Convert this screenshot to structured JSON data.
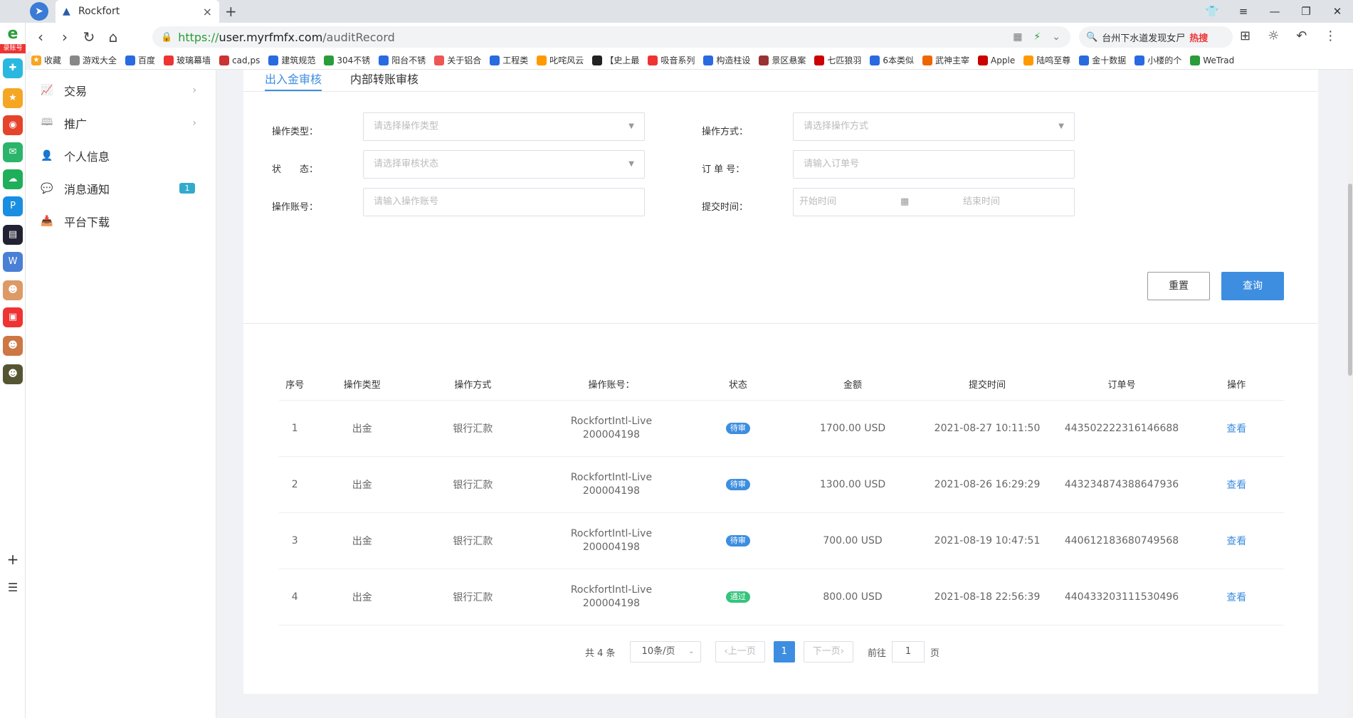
{
  "browser": {
    "tab_title": "Rockfort",
    "url_protocol": "https://",
    "url_host": "user.myrfmfx.com",
    "url_path": "/auditRecord",
    "search_text": "台州下水道发现女尸",
    "search_hot": "热搜"
  },
  "bookmarks": [
    "收藏",
    "游戏大全",
    "百度",
    "玻璃幕墙",
    "cad,ps",
    "建筑规范",
    "304不锈",
    "阳台不锈",
    "关于铝合",
    "工程类",
    "叱咤风云",
    "【史上最",
    "吸音系列",
    "构造柱设",
    "景区悬案",
    "七匹狼羽",
    "6本类似",
    "武神主宰",
    "Apple",
    "陆鸣至尊",
    "金十数据",
    "小楼的个",
    "WeTrad"
  ],
  "left_strip": {
    "top_label": "录账号"
  },
  "sidenav": [
    {
      "label": "交易",
      "icon": "chart-icon"
    },
    {
      "label": "推广",
      "icon": "book-icon"
    },
    {
      "label": "个人信息",
      "icon": "user-icon"
    },
    {
      "label": "消息通知",
      "icon": "message-icon",
      "badge": "1"
    },
    {
      "label": "平台下载",
      "icon": "download-icon"
    }
  ],
  "tabs": [
    "出入金审核",
    "内部转账审核"
  ],
  "filters": {
    "op_type_label": "操作类型：",
    "op_type_placeholder": "请选择操作类型",
    "op_method_label": "操作方式：",
    "op_method_placeholder": "请选择操作方式",
    "status_label": "状　　态：",
    "status_placeholder": "请选择审核状态",
    "order_label": "订 单 号：",
    "order_placeholder": "请输入订单号",
    "account_label": "操作账号：",
    "account_placeholder": "请输入操作账号",
    "time_label": "提交时间：",
    "time_start": "开始时间",
    "time_end": "结束时间",
    "reset": "重置",
    "query": "查询"
  },
  "table": {
    "headers": [
      "序号",
      "操作类型",
      "操作方式",
      "操作账号：",
      "状态",
      "金额",
      "提交时间",
      "订单号",
      "操作"
    ],
    "rows": [
      {
        "no": "1",
        "type": "出金",
        "method": "银行汇款",
        "acct1": "RockfortIntl-Live",
        "acct2": "200004198",
        "status": "待审",
        "amount": "1700.00 USD",
        "time": "2021-08-27 10:11:50",
        "order": "443502222316146688",
        "action": "查看"
      },
      {
        "no": "2",
        "type": "出金",
        "method": "银行汇款",
        "acct1": "RockfortIntl-Live",
        "acct2": "200004198",
        "status": "待审",
        "amount": "1300.00 USD",
        "time": "2021-08-26 16:29:29",
        "order": "443234874388647936",
        "action": "查看"
      },
      {
        "no": "3",
        "type": "出金",
        "method": "银行汇款",
        "acct1": "RockfortIntl-Live",
        "acct2": "200004198",
        "status": "待审",
        "amount": "700.00 USD",
        "time": "2021-08-19 10:47:51",
        "order": "440612183680749568",
        "action": "查看"
      },
      {
        "no": "4",
        "type": "出金",
        "method": "银行汇款",
        "acct1": "RockfortIntl-Live",
        "acct2": "200004198",
        "status": "通过",
        "amount": "800.00 USD",
        "time": "2021-08-18 22:56:39",
        "order": "440433203111530496",
        "action": "查看"
      }
    ]
  },
  "pager": {
    "total": "共 4 条",
    "size": "10条/页",
    "prev": "上一页",
    "page": "1",
    "next": "下一页",
    "goto_label": "前往",
    "goto_value": "1",
    "goto_suffix": "页"
  }
}
